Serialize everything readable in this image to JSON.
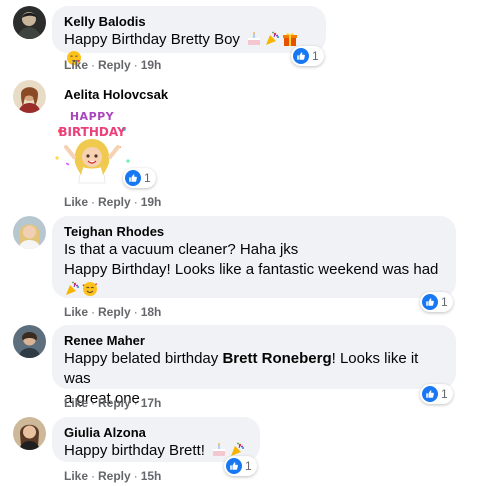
{
  "comments": [
    {
      "author": "Kelly Balodis",
      "text": "Happy Birthday Bretty Boy",
      "emojis": [
        "cake-emoji",
        "party-popper-emoji",
        "gift-emoji",
        "blowing-kiss-emoji"
      ],
      "reaction_count": "1",
      "like_label": "Like",
      "reply_label": "Reply",
      "time": "19h"
    },
    {
      "author": "Aelita Holovcsak",
      "sticker": "happy-birthday-sticker",
      "sticker_text_1": "HAPPY",
      "sticker_text_2": "BIRTHDAY",
      "reaction_count": "1",
      "like_label": "Like",
      "reply_label": "Reply",
      "time": "19h"
    },
    {
      "author": "Teighan Rhodes",
      "line1": "Is that a vacuum cleaner? Haha jks",
      "line2": "Happy Birthday! Looks like a fantastic weekend was had",
      "emojis": [
        "party-popper-emoji",
        "smiling-face-with-hearts-emoji"
      ],
      "reaction_count": "1",
      "like_label": "Like",
      "reply_label": "Reply",
      "time": "18h"
    },
    {
      "author": "Renee Maher",
      "text_before": "Happy belated birthday ",
      "mention": "Brett Roneberg",
      "text_after": "! Looks like it was",
      "line2": "a great one",
      "reaction_count": "1",
      "like_label": "Like",
      "reply_label": "Reply",
      "time": "17h"
    },
    {
      "author": "Giulia Alzona",
      "text": "Happy birthday Brett!",
      "emojis": [
        "cake-emoji",
        "party-popper-emoji"
      ],
      "reaction_count": "1",
      "like_label": "Like",
      "reply_label": "Reply",
      "time": "15h"
    }
  ],
  "separator": "·",
  "colors": {
    "bubble": "#f0f2f5",
    "like_blue": "#1877f2",
    "meta_gray": "#65676b"
  }
}
